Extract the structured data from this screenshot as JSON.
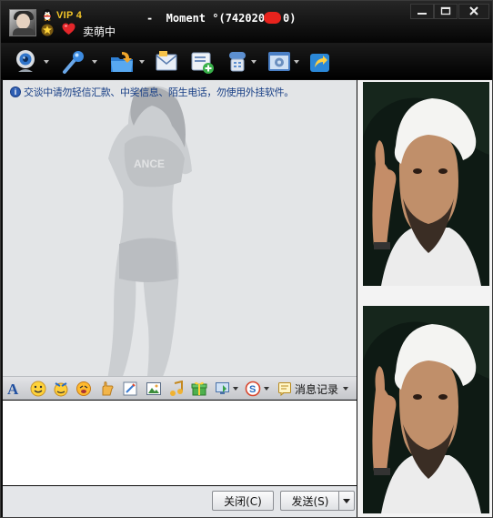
{
  "titlebar": {
    "vip_label": "VIP 4",
    "status": "卖萌中",
    "title_prefix": "-  Moment °(742020",
    "title_suffix": "0"
  },
  "toolbar": {
    "icons": [
      "video-call-icon",
      "voice-call-icon",
      "send-file-icon",
      "email-icon",
      "add-app-icon",
      "phone-icon",
      "settings-icon",
      "share-icon"
    ]
  },
  "chat": {
    "notice": "交谈中请勿轻信汇款、中奖信息、陌生电话，勿使用外挂软件。"
  },
  "input_toolbar": {
    "history_label": "消息记录"
  },
  "input": {
    "value": ""
  },
  "buttons": {
    "close_label": "关闭(C)",
    "send_label": "发送(S)"
  },
  "colors": {
    "titlebar": "#0c0c0c",
    "notice_text": "#183f86",
    "chat_bg": "#e3e5e7",
    "accent_vip": "#f3c528"
  }
}
